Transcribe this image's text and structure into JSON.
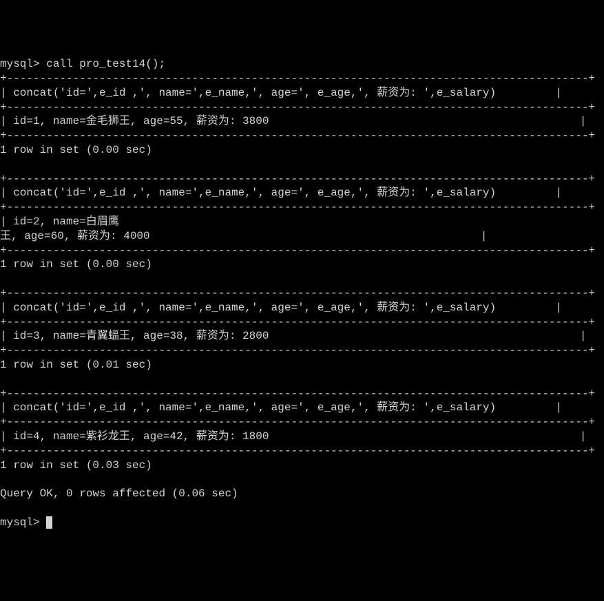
{
  "prompt": "mysql>",
  "command": "call pro_test14();",
  "header_expr": "concat('id=',e_id ,', name=',e_name,', age=', e_age,', 薪资为: ',e_salary)",
  "results": [
    {
      "data": "id=1, name=金毛狮王, age=55, 薪资为: 3800",
      "status": "1 row in set (0.00 sec)",
      "wrapped": false
    },
    {
      "data_line1": "id=2, name=白眉鹰",
      "data_line2": "王, age=60, 薪资为: 4000",
      "status": "1 row in set (0.00 sec)",
      "wrapped": true
    },
    {
      "data": "id=3, name=青翼蝠王, age=38, 薪资为: 2800",
      "status": "1 row in set (0.01 sec)",
      "wrapped": false
    },
    {
      "data": "id=4, name=紫衫龙王, age=42, 薪资为: 1800",
      "status": "1 row in set (0.03 sec)",
      "wrapped": false
    }
  ],
  "final_status": "Query OK, 0 rows affected (0.06 sec)",
  "border_top": "+----------------------------------------------------------------------------------------+",
  "border_sep": "+----------------------------------------------------------------------------------------+",
  "chart_data": {
    "type": "table",
    "title": "MySQL stored procedure pro_test14() output",
    "columns": [
      "id",
      "name",
      "age",
      "薪资"
    ],
    "rows": [
      {
        "id": 1,
        "name": "金毛狮王",
        "age": 55,
        "salary": 3800,
        "time_sec": 0.0
      },
      {
        "id": 2,
        "name": "白眉鹰王",
        "age": 60,
        "salary": 4000,
        "time_sec": 0.0
      },
      {
        "id": 3,
        "name": "青翼蝠王",
        "age": 38,
        "salary": 2800,
        "time_sec": 0.01
      },
      {
        "id": 4,
        "name": "紫衫龙王",
        "age": 42,
        "salary": 1800,
        "time_sec": 0.03
      }
    ],
    "total_time_sec": 0.06
  }
}
